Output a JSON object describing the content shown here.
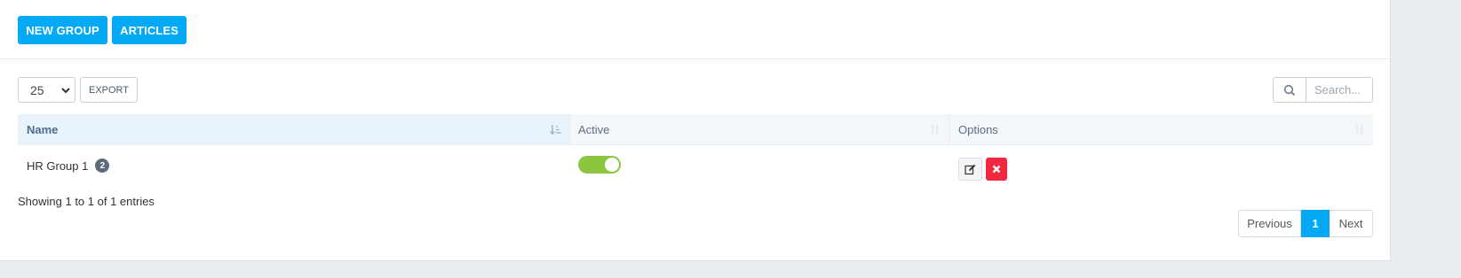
{
  "toolbar": {
    "new_group_label": "NEW GROUP",
    "articles_label": "ARTICLES"
  },
  "controls": {
    "page_length": "25",
    "export_label": "EXPORT",
    "search_placeholder": "Search..."
  },
  "table": {
    "columns": [
      "Name",
      "Active",
      "Options"
    ],
    "sorted_column": "Name",
    "rows": [
      {
        "name": "HR Group 1",
        "count_badge": "2",
        "active": true
      }
    ]
  },
  "footer": {
    "info": "Showing 1 to 1 of 1 entries"
  },
  "pagination": {
    "previous_label": "Previous",
    "current_page": "1",
    "next_label": "Next"
  },
  "colors": {
    "primary": "#03a9f4",
    "toggle_on": "#8cc63f",
    "danger": "#f1283f",
    "badge": "#5f6b78"
  }
}
